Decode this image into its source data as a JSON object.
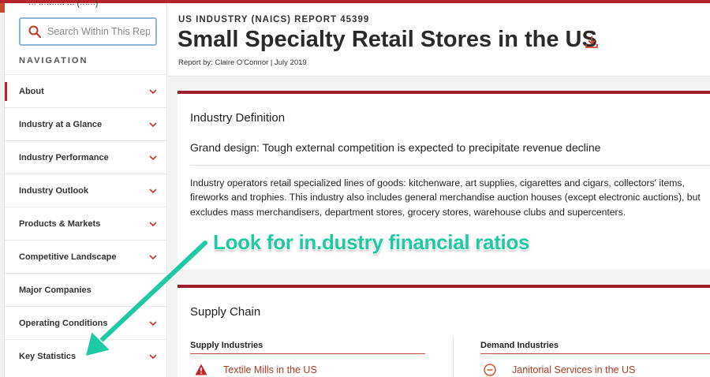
{
  "sidebar": {
    "cut_text": "··· ·········· ··· (······)",
    "search_placeholder": "Search Within This Rep",
    "nav_heading": "NAVIGATION",
    "items": [
      {
        "label": "About"
      },
      {
        "label": "Industry at a Glance"
      },
      {
        "label": "Industry Performance"
      },
      {
        "label": "Industry Outlook"
      },
      {
        "label": "Products & Markets"
      },
      {
        "label": "Competitive Landscape"
      },
      {
        "label": "Major Companies"
      },
      {
        "label": "Operating Conditions"
      },
      {
        "label": "Key Statistics"
      }
    ]
  },
  "header": {
    "eyebrow": "US INDUSTRY (NAICS) REPORT 45399",
    "title": "Small Specialty Retail Stores in the US",
    "byline": "Report by: Claire O'Connor  | July 2019"
  },
  "definition": {
    "title": "Industry Definition",
    "subhead": "Grand design: Tough external competition is expected to precipitate revenue decline",
    "paragraph": "Industry operators retail specialized lines of goods: kitchenware, art supplies, cigarettes and cigars, collectors' items, fireworks and trophies. This industry also includes general merchandise auction houses (except electronic auctions), but excludes mass merchandisers, department stores, grocery stores, warehouse clubs and supercenters."
  },
  "supply_chain": {
    "title": "Supply Chain",
    "supply_heading": "Supply Industries",
    "demand_heading": "Demand Industries",
    "supply_items": [
      {
        "label": "Textile Mills in the US",
        "icon": "warning-icon"
      }
    ],
    "demand_items": [
      {
        "label": "Janitorial Services in the US",
        "icon": "minus-circle-icon"
      }
    ]
  },
  "annotation": {
    "text": "Look for in.dustry financial ratios"
  },
  "colors": {
    "brand_red": "#b5252e",
    "link_orange": "#b03b24",
    "annotation_teal": "#1ec9a3"
  }
}
